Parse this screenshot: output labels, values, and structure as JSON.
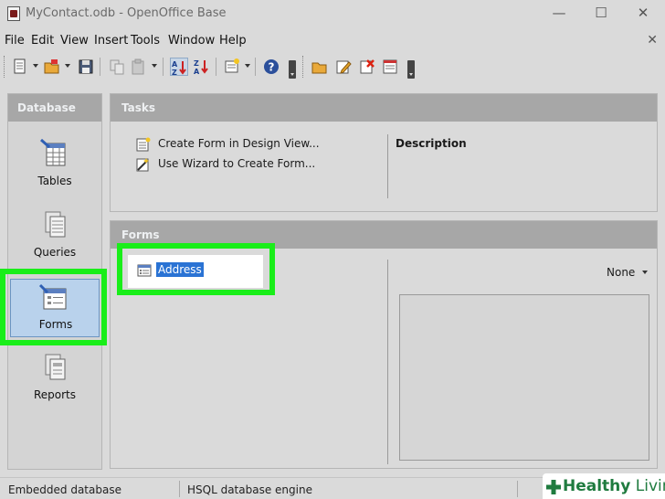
{
  "window": {
    "title": "MyContact.odb - OpenOffice Base",
    "minimize": "—",
    "maximize": "☐",
    "close": "✕"
  },
  "menu": {
    "items": [
      "File",
      "Edit",
      "View",
      "Insert",
      "Tools",
      "Window",
      "Help"
    ],
    "close": "✕"
  },
  "toolbar": {
    "buttons": [
      "new-icon",
      "open-icon",
      "save-icon",
      "copy-icon",
      "paste-icon",
      "sort-ascending-icon",
      "sort-descending-icon",
      "form-design-icon",
      "help-icon",
      "open-folder-icon",
      "edit-icon",
      "delete-icon",
      "rename-icon"
    ],
    "sort_ascending_active": true
  },
  "sidebar": {
    "header": "Database",
    "items": [
      {
        "label": "Tables",
        "icon": "table-icon",
        "selected": false
      },
      {
        "label": "Queries",
        "icon": "query-icon",
        "selected": false
      },
      {
        "label": "Forms",
        "icon": "form-icon",
        "selected": true
      },
      {
        "label": "Reports",
        "icon": "report-icon",
        "selected": false
      }
    ]
  },
  "tasks": {
    "header": "Tasks",
    "items": [
      {
        "label": "Create Form in Design View...",
        "icon": "form-design-icon"
      },
      {
        "label": "Use Wizard to Create Form...",
        "icon": "wizard-icon"
      }
    ],
    "description_label": "Description"
  },
  "forms": {
    "header": "Forms",
    "items": [
      {
        "name": "Address",
        "icon": "form-document-icon",
        "selected": true
      }
    ],
    "preview_mode": "None"
  },
  "statusbar": {
    "database_type": "Embedded database",
    "engine": "HSQL database engine"
  },
  "watermark": {
    "part1": "Healthy",
    "part2": " Living"
  },
  "colors": {
    "highlight_green": "#19ee19",
    "selection_blue": "#2a73d4",
    "header_gray": "#a7a7a7"
  }
}
